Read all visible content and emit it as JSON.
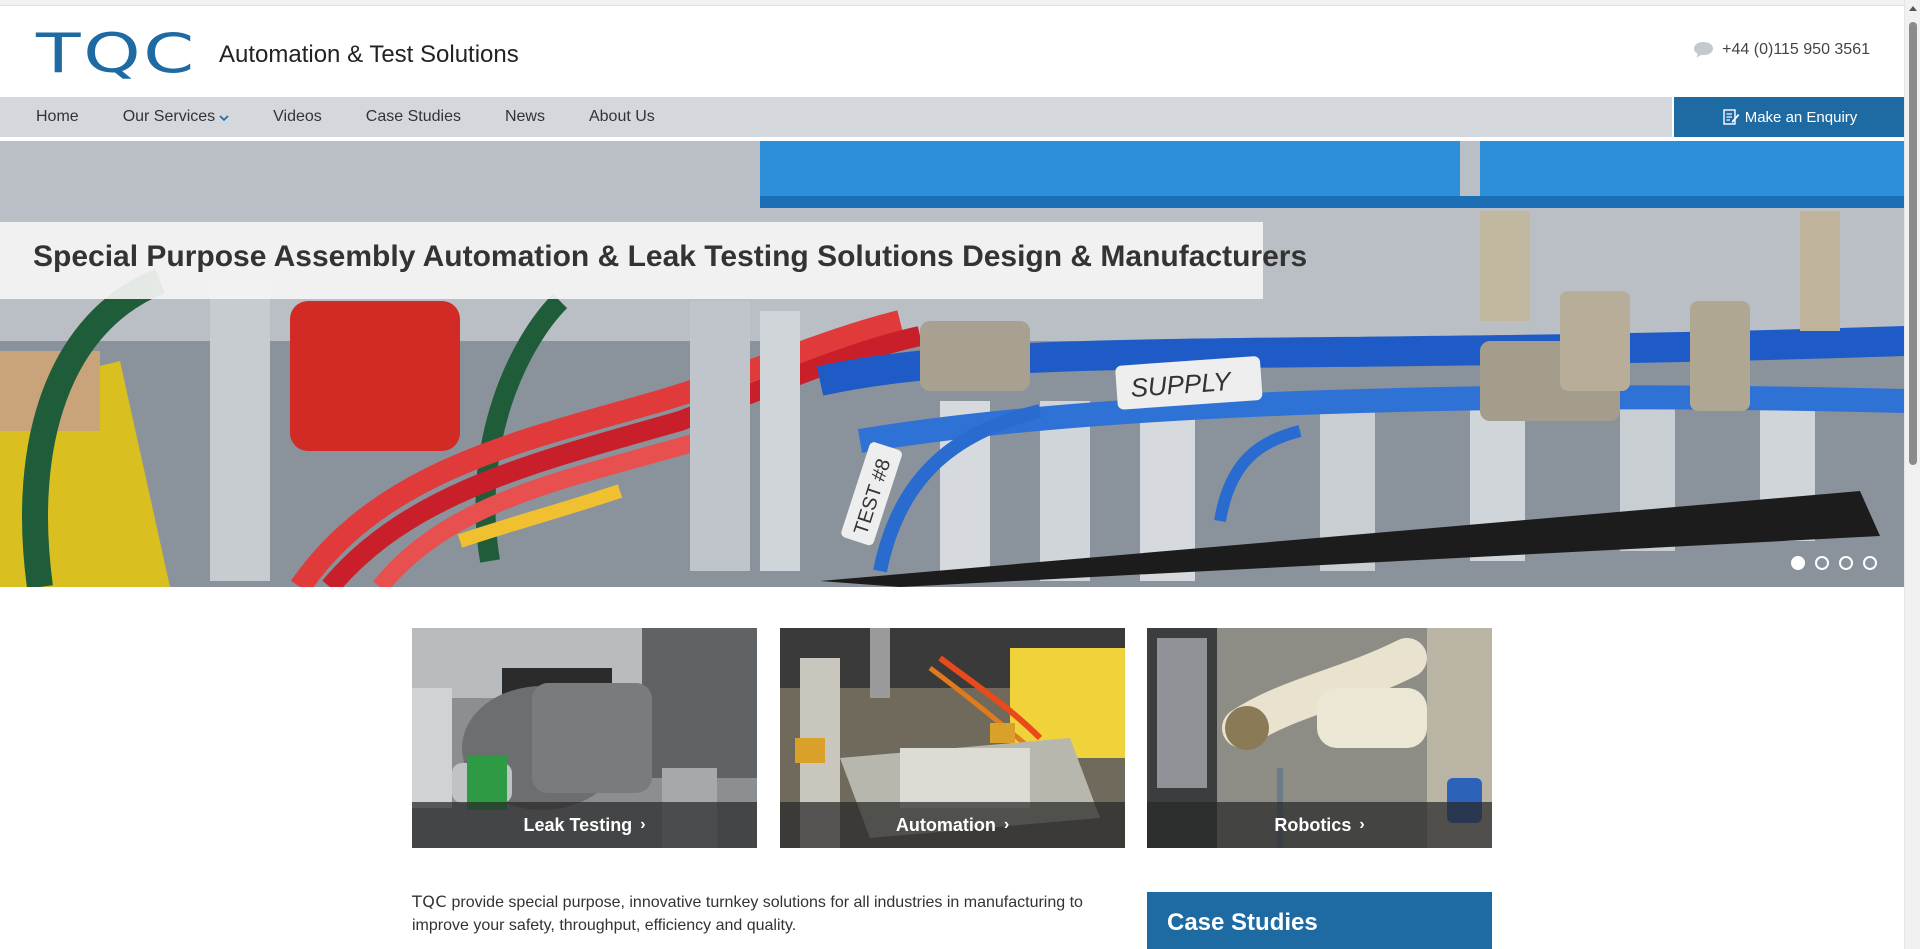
{
  "header": {
    "logo_mark": "TQC",
    "tagline": "Automation & Test Solutions",
    "phone": "+44 (0)115 950 3561",
    "phone_icon": "chat-bubble-icon"
  },
  "nav": {
    "items": [
      {
        "label": "Home"
      },
      {
        "label": "Our Services"
      },
      {
        "label": "Videos"
      },
      {
        "label": "Case Studies"
      },
      {
        "label": "News"
      },
      {
        "label": "About Us"
      }
    ],
    "enquiry_label": "Make an Enquiry",
    "enquiry_icon": "edit-form-icon"
  },
  "hero": {
    "title": "Special Purpose Assembly Automation & Leak Testing Solutions Design & Manufacturers",
    "slide_count": 4,
    "active_slide": 1,
    "photo_tags": [
      "SUPPLY",
      "TEST #8"
    ]
  },
  "tiles": [
    {
      "label": "Leak Testing",
      "arrow": "›"
    },
    {
      "label": "Automation",
      "arrow": "›"
    },
    {
      "label": "Robotics",
      "arrow": "›"
    }
  ],
  "intro": {
    "brand": "TQC",
    "text": " provide special purpose, innovative turnkey solutions for all industries in manufacturing to improve your safety, throughput, efficiency and quality."
  },
  "sidebar": {
    "case_studies_title": "Case Studies"
  },
  "colors": {
    "brand_blue": "#1e6aa3",
    "nav_bg": "#d4d8dc"
  }
}
